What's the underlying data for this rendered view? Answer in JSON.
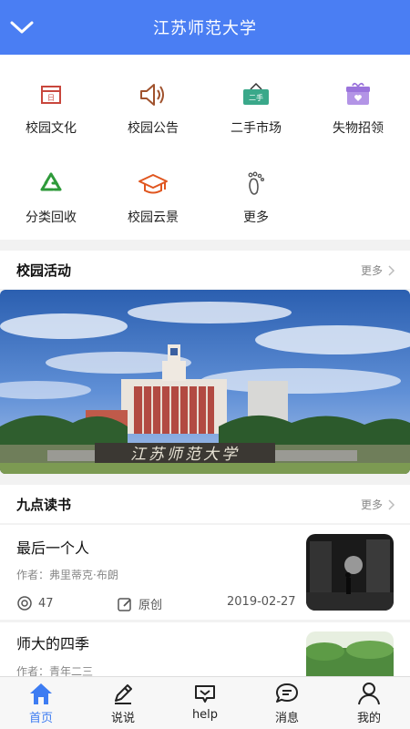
{
  "header": {
    "title": "江苏师范大学"
  },
  "grid": [
    {
      "label": "校园文化",
      "icon": "calendar-icon"
    },
    {
      "label": "校园公告",
      "icon": "speaker-icon"
    },
    {
      "label": "二手市场",
      "icon": "sign-icon"
    },
    {
      "label": "失物招领",
      "icon": "gift-box-icon"
    },
    {
      "label": "分类回收",
      "icon": "recycle-icon"
    },
    {
      "label": "校园云景",
      "icon": "graduation-cap-icon"
    },
    {
      "label": "更多",
      "icon": "footprint-icon"
    }
  ],
  "activities": {
    "title": "校园活动",
    "more": "更多",
    "banner_sign": "江苏师范大学"
  },
  "reading": {
    "title": "九点读书",
    "more": "更多"
  },
  "articles": [
    {
      "title": "最后一个人",
      "author": "作者：弗里蒂克·布朗",
      "views": "47",
      "type": "原创",
      "date": "2019-02-27"
    },
    {
      "title": "师大的四季",
      "author": "作者：青年二三"
    }
  ],
  "grid_sign_text": "二手",
  "tabs": [
    {
      "label": "首页",
      "icon": "home-icon"
    },
    {
      "label": "说说",
      "icon": "pencil-icon"
    },
    {
      "label": "help",
      "icon": "message-heart-icon"
    },
    {
      "label": "消息",
      "icon": "chat-bubble-icon"
    },
    {
      "label": "我的",
      "icon": "user-icon"
    }
  ],
  "colors": {
    "primary": "#4a7ef3",
    "tab_active": "#3d7cf2"
  }
}
